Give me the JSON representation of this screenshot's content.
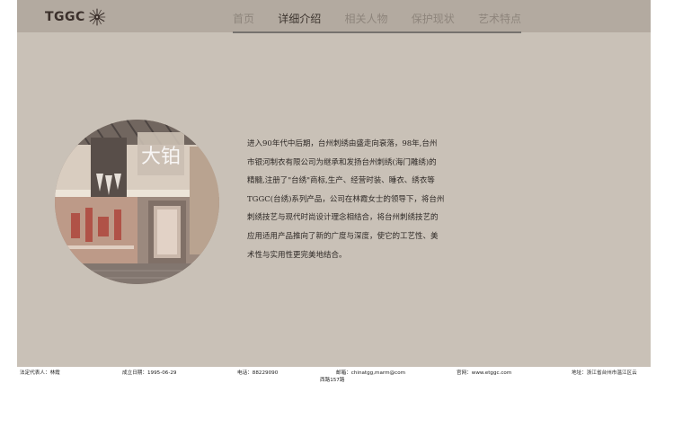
{
  "header": {
    "logo_text": "TGGC",
    "nav": [
      {
        "label": "首页",
        "active": false
      },
      {
        "label": "详细介绍",
        "active": true
      },
      {
        "label": "相关人物",
        "active": false
      },
      {
        "label": "保护现状",
        "active": false
      },
      {
        "label": "艺术特点",
        "active": false
      }
    ]
  },
  "main": {
    "image": {
      "sign_text": "大铂"
    },
    "paragraph_lines": [
      "进入90年代中后期，台州刺绣由盛走向衰落，98年,台州",
      "市银河制衣有限公司为继承和发扬台州刺绣(海门雕绣)的",
      "精髓,注册了\"台绣\"商标,生产、经营时装、睡衣、绣衣等",
      "TGGC(台绣)系列产品，公司在林霞女士的领导下，将台州",
      "刺绣技艺与现代时尚设计理念相结合，将台州刺绣技艺的",
      "应用适用产品推向了新的广度与深度，使它的工艺性、美",
      "术性与实用性更完美地结合。"
    ]
  },
  "footer": {
    "legal_rep": "法定代表人：林霞",
    "founded": "成立日期：1995-06-29",
    "phone": "电话：88229090",
    "email": "邮箱：chinatgg,marm@com",
    "website": "官网：www.etggc.com",
    "address_line1": "地址：浙江省台州市温江区云",
    "address_line2": "西路157路"
  },
  "colors": {
    "page_bg": "#c9c1b7",
    "header_bg": "#b3aaa0",
    "nav_active": "#3d352f",
    "nav_inactive": "#8e857c"
  }
}
